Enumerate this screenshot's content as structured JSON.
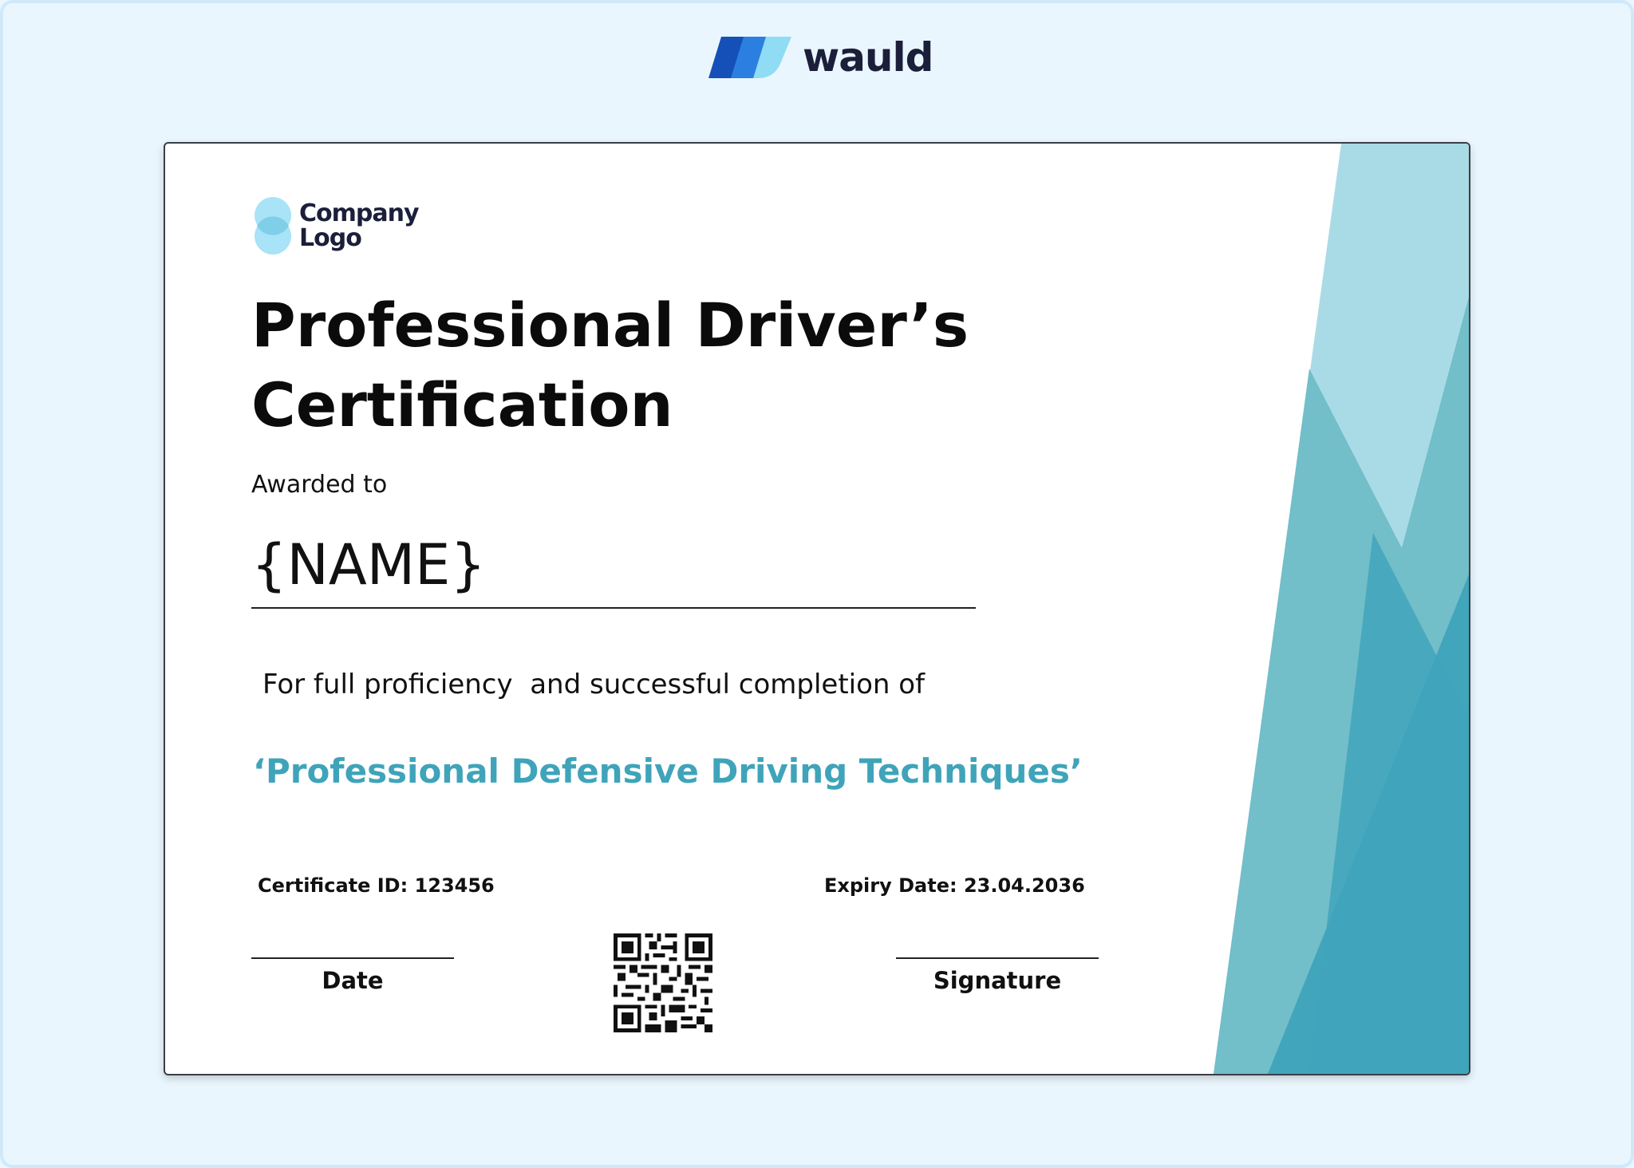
{
  "brand": {
    "name": "wauld",
    "colors": {
      "dark_blue": "#1450b8",
      "mid_blue": "#2b7fe0",
      "light_blue": "#8fdcf4",
      "text": "#1b1f3a"
    }
  },
  "certificate": {
    "company_logo": {
      "line1": "Company",
      "line2": "Logo"
    },
    "title_line1": "Professional Driver’s",
    "title_line2": "Certification",
    "awarded_to": "Awarded to",
    "name": "{NAME}",
    "completion_text": "For full proficiency  and successful completion of",
    "course": "‘Professional Defensive Driving Techniques’",
    "certificate_id": "Certificate ID: 123456",
    "expiry_date": "Expiry Date: 23.04.2036",
    "date_label": "Date",
    "signature_label": "Signature",
    "accent_color": "#3fa4ba"
  }
}
